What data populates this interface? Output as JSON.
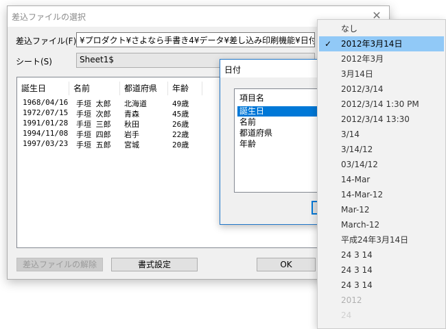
{
  "window": {
    "title": "差込ファイルの選択",
    "close_glyph": "✕",
    "file_label": "差込ファイル(F)",
    "file_value": "¥プロダクト¥さよなら手書き4¥データ¥差し込み印刷機能¥日付形式選択",
    "sheet_label": "シート(S)",
    "sheet_value": "Sheet1$"
  },
  "table": {
    "headers": [
      "誕生日",
      "名前",
      "都道府県",
      "年齢"
    ],
    "rows": [
      [
        "1968/04/16",
        "手垣 太郎",
        "北海道",
        "49歳"
      ],
      [
        "1972/07/15",
        "手垣 次郎",
        "青森",
        "45歳"
      ],
      [
        "1991/01/28",
        "手垣 三郎",
        "秋田",
        "26歳"
      ],
      [
        "1994/11/08",
        "手垣 四郎",
        "岩手",
        "22歳"
      ],
      [
        "1997/03/23",
        "手垣 五郎",
        "宮城",
        "20歳"
      ]
    ]
  },
  "buttons": {
    "release": "差込ファイルの解除",
    "format": "書式設定",
    "ok": "OK"
  },
  "date_dialog": {
    "title": "日付",
    "list_header": "項目名",
    "items": [
      "誕生日",
      "名前",
      "都道府県",
      "年齢"
    ],
    "selected_index": 0
  },
  "format_menu": {
    "selected_index": 1,
    "items": [
      "なし",
      "2012年3月14日",
      "2012年3月",
      "3月14日",
      "2012/3/14",
      "2012/3/14 1:30 PM",
      "2012/3/14 13:30",
      "3/14",
      "3/14/12",
      "03/14/12",
      "14-Mar",
      "14-Mar-12",
      "Mar-12",
      "March-12",
      "平成24年3月14日",
      "24  3 14",
      "24   3  14",
      "24    3    14",
      "2012",
      "24"
    ],
    "check_glyph": "✓"
  }
}
